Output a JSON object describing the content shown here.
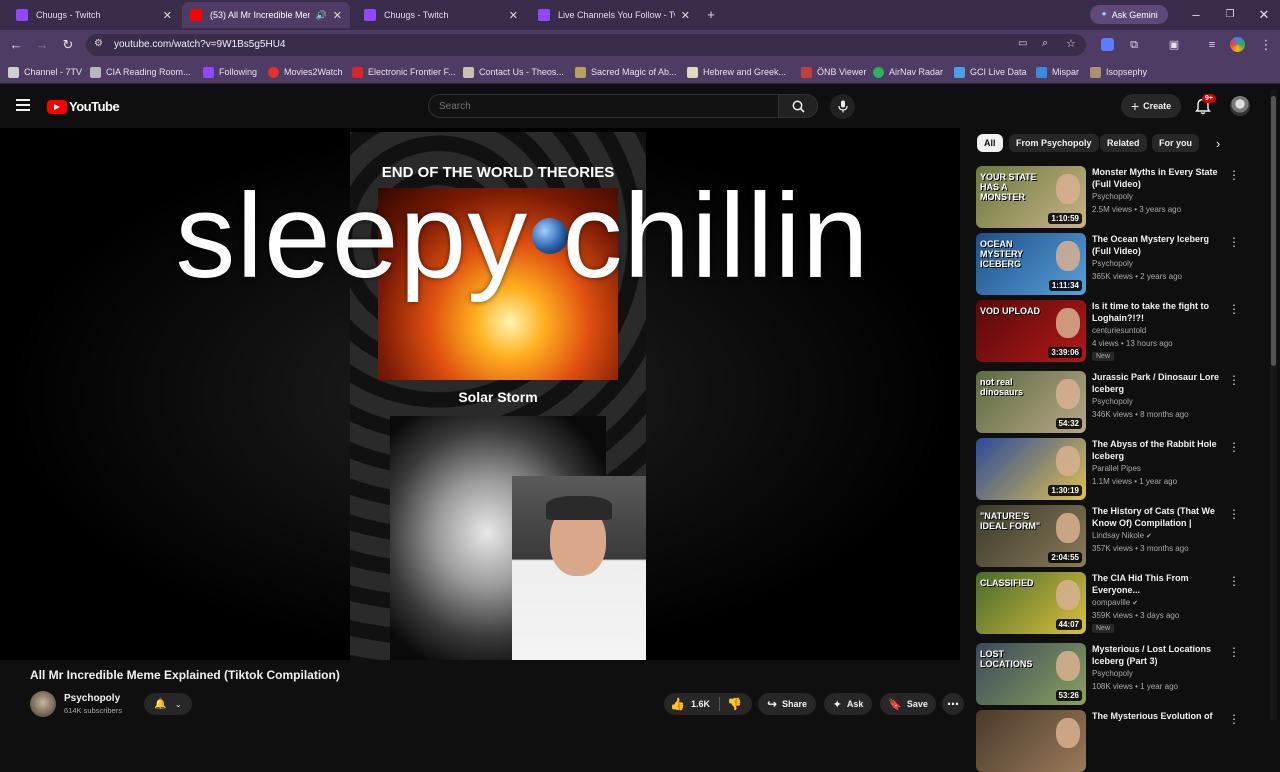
{
  "browser": {
    "tabs": [
      {
        "title": "Chuugs - Twitch",
        "color": "#9146ff"
      },
      {
        "title": "(53) All Mr Incredible Meme",
        "color": "#ff0000"
      },
      {
        "title": "Chuugs - Twitch",
        "color": "#9146ff"
      },
      {
        "title": "Live Channels You Follow - Twit",
        "color": "#9146ff"
      }
    ],
    "ask_gemini": "Ask Gemini",
    "url": "youtube.com/watch?v=9W1Bs5g5HU4",
    "bookmarks": [
      {
        "label": "Channel - 7TV",
        "color": "#cfcfcf"
      },
      {
        "label": "CIA Reading Room...",
        "color": "#b8b8b8"
      },
      {
        "label": "Following",
        "color": "#9146ff"
      },
      {
        "label": "Movies2Watch",
        "color": "#e03030"
      },
      {
        "label": "Electronic Frontier F...",
        "color": "#d8262b"
      },
      {
        "label": "Contact Us - Theos...",
        "color": "#c9c2b0"
      },
      {
        "label": "Sacred Magic of Ab...",
        "color": "#b8a060"
      },
      {
        "label": "Hebrew and Greek...",
        "color": "#e0d8c0"
      },
      {
        "label": "ÖNB Viewer",
        "color": "#c04040"
      },
      {
        "label": "AirNav Radar",
        "color": "#2fb05a"
      },
      {
        "label": "GCI Live Data",
        "color": "#4aa0e0"
      },
      {
        "label": "Mispar",
        "color": "#3a8ae0"
      },
      {
        "label": "Isopsephy",
        "color": "#a89070"
      }
    ]
  },
  "youtube": {
    "logo_text": "YouTube",
    "search_placeholder": "Search",
    "create_label": "Create",
    "notif_count": "9+",
    "chips": [
      "All",
      "From Psychopoly",
      "Related",
      "For you"
    ],
    "video": {
      "overlay_text": "sleepy chillin",
      "frame_title": "END OF THE WORLD THEORIES",
      "frame_caption": "Solar Storm",
      "title": "All Mr Incredible Meme Explained (Tiktok Compilation)",
      "channel": "Psychopoly",
      "subscribers": "614K subscribers",
      "likes": "1.6K",
      "share": "Share",
      "ask": "Ask",
      "save": "Save"
    },
    "recommendations": [
      {
        "title": "Monster Myths in Every State (Full Video)",
        "channel": "Psychopoly",
        "meta": "2.5M views • 3 years ago",
        "duration": "1:10:59",
        "thumb_text": "YOUR STATE HAS A MONSTER",
        "colors": [
          "#6a7a3a",
          "#c9b28a"
        ],
        "verified": false,
        "new": false
      },
      {
        "title": "The Ocean Mystery Iceberg (Full Video)",
        "channel": "Psychopoly",
        "meta": "365K views • 2 years ago",
        "duration": "1:11:34",
        "thumb_text": "OCEAN MYSTERY ICEBERG",
        "colors": [
          "#1d4f8a",
          "#5aa0d8"
        ],
        "verified": false,
        "new": false
      },
      {
        "title": "Is it time to take the fight to Loghain?!?!",
        "channel": "centuriesuntold",
        "meta": "4 views • 13 hours ago",
        "duration": "3:39:06",
        "thumb_text": "VOD UPLOAD",
        "colors": [
          "#5a0a0a",
          "#b21818"
        ],
        "verified": false,
        "new": true
      },
      {
        "title": "Jurassic Park / Dinosaur Lore Iceberg",
        "channel": "Psychopoly",
        "meta": "346K views • 8 months ago",
        "duration": "54:32",
        "thumb_text": "not real dinosaurs",
        "colors": [
          "#5c6a40",
          "#b8a888"
        ],
        "verified": false,
        "new": false
      },
      {
        "title": "The Abyss of the Rabbit Hole Iceberg",
        "channel": "Parallel Pipes",
        "meta": "1.1M views • 1 year ago",
        "duration": "1:30:19",
        "thumb_text": "",
        "colors": [
          "#2a4a9a",
          "#e0c050"
        ],
        "verified": false,
        "new": false
      },
      {
        "title": "The History of Cats (That We Know Of) Compilation | Lindsa...",
        "channel": "Lindsay Nikole",
        "meta": "357K views • 3 months ago",
        "duration": "2:04:55",
        "thumb_text": "\"NATURE'S IDEAL FORM\"",
        "colors": [
          "#3a3a2a",
          "#8a7a5a"
        ],
        "verified": true,
        "new": false
      },
      {
        "title": "The CIA Hid This From Everyone...",
        "channel": "oompaville",
        "meta": "359K views • 3 days ago",
        "duration": "44:07",
        "thumb_text": "CLASSIFIED",
        "colors": [
          "#4a6a2a",
          "#d8c040"
        ],
        "verified": true,
        "new": true
      },
      {
        "title": "Mysterious / Lost Locations Iceberg (Part 3)",
        "channel": "Psychopoly",
        "meta": "108K views • 1 year ago",
        "duration": "53:26",
        "thumb_text": "LOST LOCATIONS",
        "colors": [
          "#3a4a5a",
          "#8aa060"
        ],
        "verified": false,
        "new": false
      },
      {
        "title": "The Mysterious Evolution of",
        "channel": "",
        "meta": "",
        "duration": "",
        "thumb_text": "",
        "colors": [
          "#4a3a2a",
          "#9a7a5a"
        ],
        "verified": false,
        "new": false
      }
    ]
  }
}
